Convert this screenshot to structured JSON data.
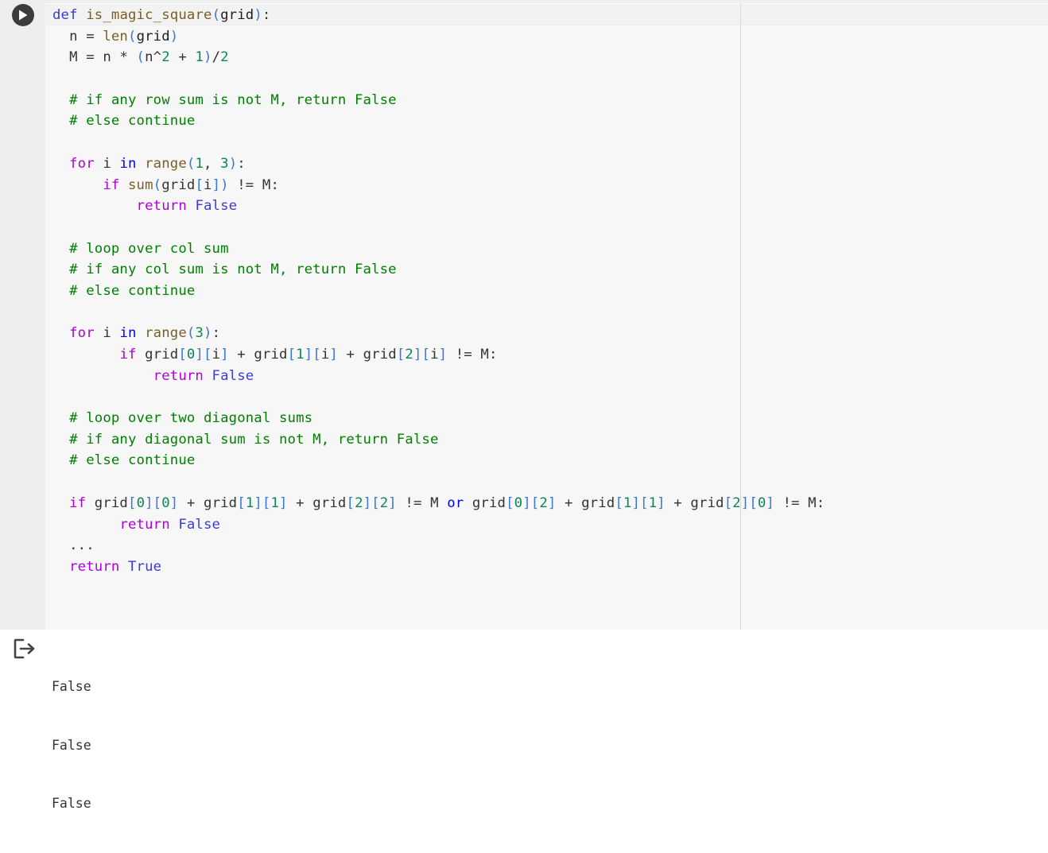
{
  "cell": {
    "run_button_label": "Run cell",
    "code_lines": [
      [
        {
          "t": "def",
          "c": "def"
        },
        {
          "t": " "
        },
        {
          "t": "is_magic_square",
          "c": "fn"
        },
        {
          "t": "(",
          "c": "br"
        },
        {
          "t": "grid",
          "c": "var"
        },
        {
          "t": ")",
          "c": "br"
        },
        {
          "t": ":"
        }
      ],
      [
        {
          "t": "  n = "
        },
        {
          "t": "len",
          "c": "fn"
        },
        {
          "t": "(",
          "c": "br"
        },
        {
          "t": "grid",
          "c": "var"
        },
        {
          "t": ")",
          "c": "br"
        }
      ],
      [
        {
          "t": "  M = n * "
        },
        {
          "t": "(",
          "c": "br"
        },
        {
          "t": "n^"
        },
        {
          "t": "2",
          "c": "num"
        },
        {
          "t": " + "
        },
        {
          "t": "1",
          "c": "num"
        },
        {
          "t": ")",
          "c": "br"
        },
        {
          "t": "/"
        },
        {
          "t": "2",
          "c": "num"
        }
      ],
      [
        {
          "t": ""
        }
      ],
      [
        {
          "t": "  # if any row sum is not M, return False",
          "c": "cmt"
        }
      ],
      [
        {
          "t": "  # else continue",
          "c": "cmt"
        }
      ],
      [
        {
          "t": ""
        }
      ],
      [
        {
          "t": "  "
        },
        {
          "t": "for",
          "c": "kw"
        },
        {
          "t": " i "
        },
        {
          "t": "in",
          "c": "kw2"
        },
        {
          "t": " "
        },
        {
          "t": "range",
          "c": "fn"
        },
        {
          "t": "(",
          "c": "br"
        },
        {
          "t": "1",
          "c": "num"
        },
        {
          "t": ", "
        },
        {
          "t": "3",
          "c": "num"
        },
        {
          "t": ")",
          "c": "br"
        },
        {
          "t": ":"
        }
      ],
      [
        {
          "t": "      "
        },
        {
          "t": "if",
          "c": "kw"
        },
        {
          "t": " "
        },
        {
          "t": "sum",
          "c": "fn"
        },
        {
          "t": "(",
          "c": "br"
        },
        {
          "t": "grid"
        },
        {
          "t": "[",
          "c": "br"
        },
        {
          "t": "i"
        },
        {
          "t": "])",
          "c": "br"
        },
        {
          "t": " != M:"
        }
      ],
      [
        {
          "t": "          "
        },
        {
          "t": "return",
          "c": "kw"
        },
        {
          "t": " "
        },
        {
          "t": "False",
          "c": "bool"
        }
      ],
      [
        {
          "t": ""
        }
      ],
      [
        {
          "t": "  # loop over col sum",
          "c": "cmt"
        }
      ],
      [
        {
          "t": "  # if any col sum is not M, return False",
          "c": "cmt"
        }
      ],
      [
        {
          "t": "  # else continue",
          "c": "cmt"
        }
      ],
      [
        {
          "t": ""
        }
      ],
      [
        {
          "t": "  "
        },
        {
          "t": "for",
          "c": "kw"
        },
        {
          "t": " i "
        },
        {
          "t": "in",
          "c": "kw2"
        },
        {
          "t": " "
        },
        {
          "t": "range",
          "c": "fn"
        },
        {
          "t": "(",
          "c": "br"
        },
        {
          "t": "3",
          "c": "num"
        },
        {
          "t": ")",
          "c": "br"
        },
        {
          "t": ":"
        }
      ],
      [
        {
          "t": "        "
        },
        {
          "t": "if",
          "c": "kw"
        },
        {
          "t": " grid"
        },
        {
          "t": "[",
          "c": "br"
        },
        {
          "t": "0",
          "c": "num"
        },
        {
          "t": "][",
          "c": "br"
        },
        {
          "t": "i"
        },
        {
          "t": "]",
          "c": "br"
        },
        {
          "t": " + grid"
        },
        {
          "t": "[",
          "c": "br"
        },
        {
          "t": "1",
          "c": "num"
        },
        {
          "t": "][",
          "c": "br"
        },
        {
          "t": "i"
        },
        {
          "t": "]",
          "c": "br"
        },
        {
          "t": " + grid"
        },
        {
          "t": "[",
          "c": "br"
        },
        {
          "t": "2",
          "c": "num"
        },
        {
          "t": "][",
          "c": "br"
        },
        {
          "t": "i"
        },
        {
          "t": "]",
          "c": "br"
        },
        {
          "t": " != M:"
        }
      ],
      [
        {
          "t": "            "
        },
        {
          "t": "return",
          "c": "kw"
        },
        {
          "t": " "
        },
        {
          "t": "False",
          "c": "bool"
        }
      ],
      [
        {
          "t": ""
        }
      ],
      [
        {
          "t": "  # loop over two diagonal sums",
          "c": "cmt"
        }
      ],
      [
        {
          "t": "  # if any diagonal sum is not M, return False",
          "c": "cmt"
        }
      ],
      [
        {
          "t": "  # else continue",
          "c": "cmt"
        }
      ],
      [
        {
          "t": ""
        }
      ],
      [
        {
          "t": "  "
        },
        {
          "t": "if",
          "c": "kw"
        },
        {
          "t": " grid"
        },
        {
          "t": "[",
          "c": "br"
        },
        {
          "t": "0",
          "c": "num"
        },
        {
          "t": "][",
          "c": "br"
        },
        {
          "t": "0",
          "c": "num"
        },
        {
          "t": "]",
          "c": "br"
        },
        {
          "t": " + grid"
        },
        {
          "t": "[",
          "c": "br"
        },
        {
          "t": "1",
          "c": "num"
        },
        {
          "t": "][",
          "c": "br"
        },
        {
          "t": "1",
          "c": "num"
        },
        {
          "t": "]",
          "c": "br"
        },
        {
          "t": " + grid"
        },
        {
          "t": "[",
          "c": "br"
        },
        {
          "t": "2",
          "c": "num"
        },
        {
          "t": "][",
          "c": "br"
        },
        {
          "t": "2",
          "c": "num"
        },
        {
          "t": "]",
          "c": "br"
        },
        {
          "t": " != M "
        },
        {
          "t": "or",
          "c": "kw2"
        },
        {
          "t": " grid"
        },
        {
          "t": "[",
          "c": "br"
        },
        {
          "t": "0",
          "c": "num"
        },
        {
          "t": "][",
          "c": "br"
        },
        {
          "t": "2",
          "c": "num"
        },
        {
          "t": "]",
          "c": "br"
        },
        {
          "t": " + grid"
        },
        {
          "t": "[",
          "c": "br"
        },
        {
          "t": "1",
          "c": "num"
        },
        {
          "t": "][",
          "c": "br"
        },
        {
          "t": "1",
          "c": "num"
        },
        {
          "t": "]",
          "c": "br"
        },
        {
          "t": " + grid"
        },
        {
          "t": "[",
          "c": "br"
        },
        {
          "t": "2",
          "c": "num"
        },
        {
          "t": "][",
          "c": "br"
        },
        {
          "t": "0",
          "c": "num"
        },
        {
          "t": "]",
          "c": "br"
        },
        {
          "t": " != M:"
        }
      ],
      [
        {
          "t": "        "
        },
        {
          "t": "return",
          "c": "kw"
        },
        {
          "t": " "
        },
        {
          "t": "False",
          "c": "bool"
        }
      ],
      [
        {
          "t": "  ..."
        }
      ],
      [
        {
          "t": "  "
        },
        {
          "t": "return",
          "c": "kw"
        },
        {
          "t": " "
        },
        {
          "t": "True",
          "c": "bool"
        }
      ]
    ]
  },
  "output": {
    "icon": "output-redirect-icon",
    "lines": [
      "False",
      "False",
      "False"
    ]
  }
}
